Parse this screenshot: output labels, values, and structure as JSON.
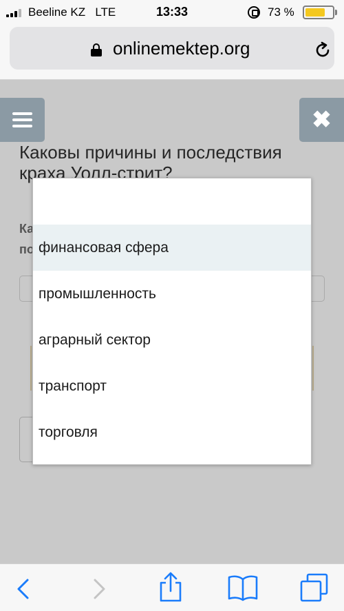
{
  "status_bar": {
    "carrier": "Beeline KZ",
    "network": "LTE",
    "time": "13:33",
    "battery_percent": "73 %",
    "battery_level": 0.73,
    "battery_color": "#f4c81f",
    "icons": [
      "signal-icon",
      "rotation-lock-icon",
      "battery-icon"
    ]
  },
  "browser": {
    "url": "onlinemektep.org",
    "icons": [
      "lock-icon",
      "reload-icon"
    ]
  },
  "page": {
    "menu_icon": "hamburger-icon",
    "close_icon": "close-icon",
    "close_glyph": "✖",
    "question_title": "Каковы причины и последствия краха Уолл-стрит?",
    "label_partial": [
      "Ка",
      "по"
    ],
    "accent_color": "#8b9aa4"
  },
  "dropdown": {
    "options": [
      {
        "label": ""
      },
      {
        "label": "финансовая сфера",
        "highlighted": true
      },
      {
        "label": "промышленность"
      },
      {
        "label": "аграрный сектор"
      },
      {
        "label": "транспорт"
      },
      {
        "label": "торговля"
      }
    ]
  },
  "toolbar": {
    "icons": [
      "back-icon",
      "forward-icon",
      "share-icon",
      "bookmarks-icon",
      "tabs-icon"
    ],
    "active_color": "#1a7cfb",
    "disabled_color": "#c4c4c4"
  }
}
